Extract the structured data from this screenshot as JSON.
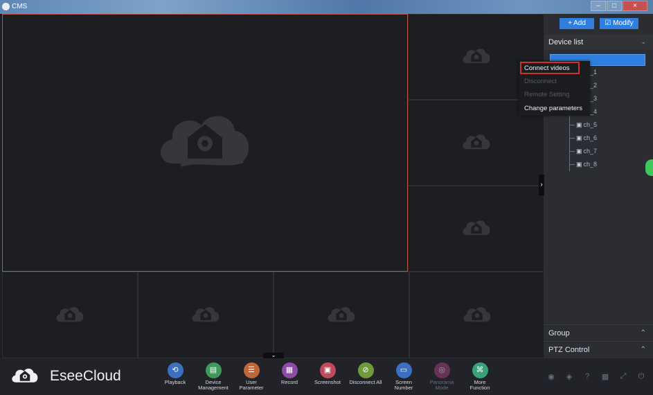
{
  "window": {
    "title": "CMS",
    "minimize": "–",
    "maximize": "□",
    "close": "×"
  },
  "panel": {
    "add_label": "+ Add",
    "modify_label": "☑ Modify",
    "device_list": "Device list",
    "channels": [
      "ch_1",
      "ch_2",
      "ch_3",
      "ch_4",
      "ch_5",
      "ch_6",
      "ch_7",
      "ch_8"
    ],
    "group": "Group",
    "ptz": "PTZ Control"
  },
  "context_menu": {
    "items": [
      {
        "label": "Connect videos",
        "enabled": true
      },
      {
        "label": "Disconnect",
        "enabled": false
      },
      {
        "label": "Remote Setting",
        "enabled": false
      },
      {
        "label": "Change parameters",
        "enabled": true
      }
    ]
  },
  "toolbar": {
    "brand": "EseeCloud",
    "tools": [
      {
        "label": "Playback",
        "color": "#3a6fc1"
      },
      {
        "label": "Device\nManagement",
        "color": "#3d9a5b"
      },
      {
        "label": "User\nParameter",
        "color": "#c0643a"
      },
      {
        "label": "Record",
        "color": "#8e4aa8"
      },
      {
        "label": "Screenshot",
        "color": "#c04a5a"
      },
      {
        "label": "Disconnect All",
        "color": "#6f9a3a"
      },
      {
        "label": "Screen\nNumber",
        "color": "#3a6fc1"
      },
      {
        "label": "Panorama\nMode",
        "color": "#a0407a"
      },
      {
        "label": "More\nFunction",
        "color": "#3aa07a"
      }
    ]
  },
  "colors": {
    "accent": "#2f7fe0",
    "main_cell_border": "#b9564a",
    "highlight": "#d32f2f"
  }
}
